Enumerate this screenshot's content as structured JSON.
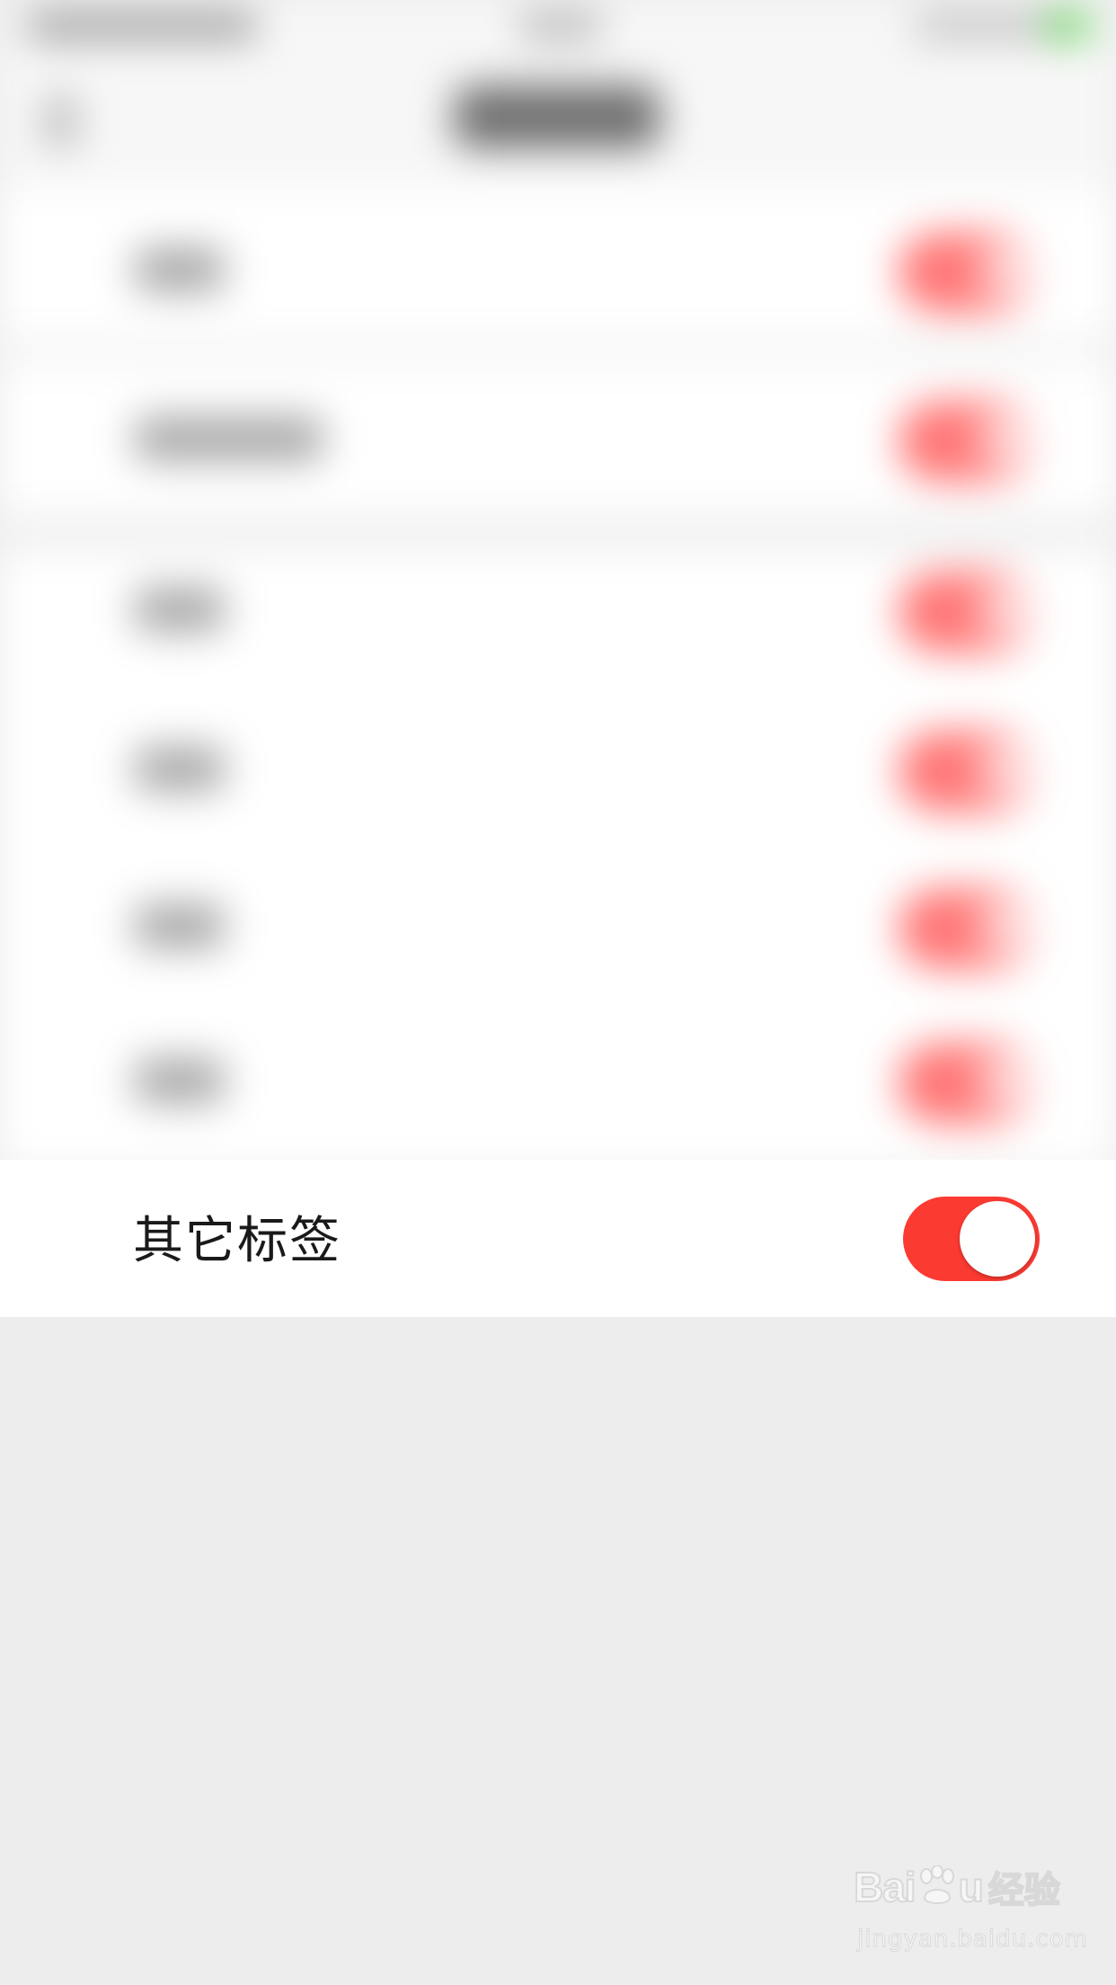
{
  "settings_list": {
    "visible_row": {
      "label": "其它标签",
      "toggle_on": true
    }
  },
  "colors": {
    "toggle_on": "#fb3a32",
    "page_background": "#ededed",
    "row_background": "#ffffff",
    "label_text": "#1a1a1a"
  },
  "watermark": {
    "brand": "Bai",
    "brand_suffix": "u",
    "cn": "经验",
    "url": "jingyan.baidu.com"
  }
}
